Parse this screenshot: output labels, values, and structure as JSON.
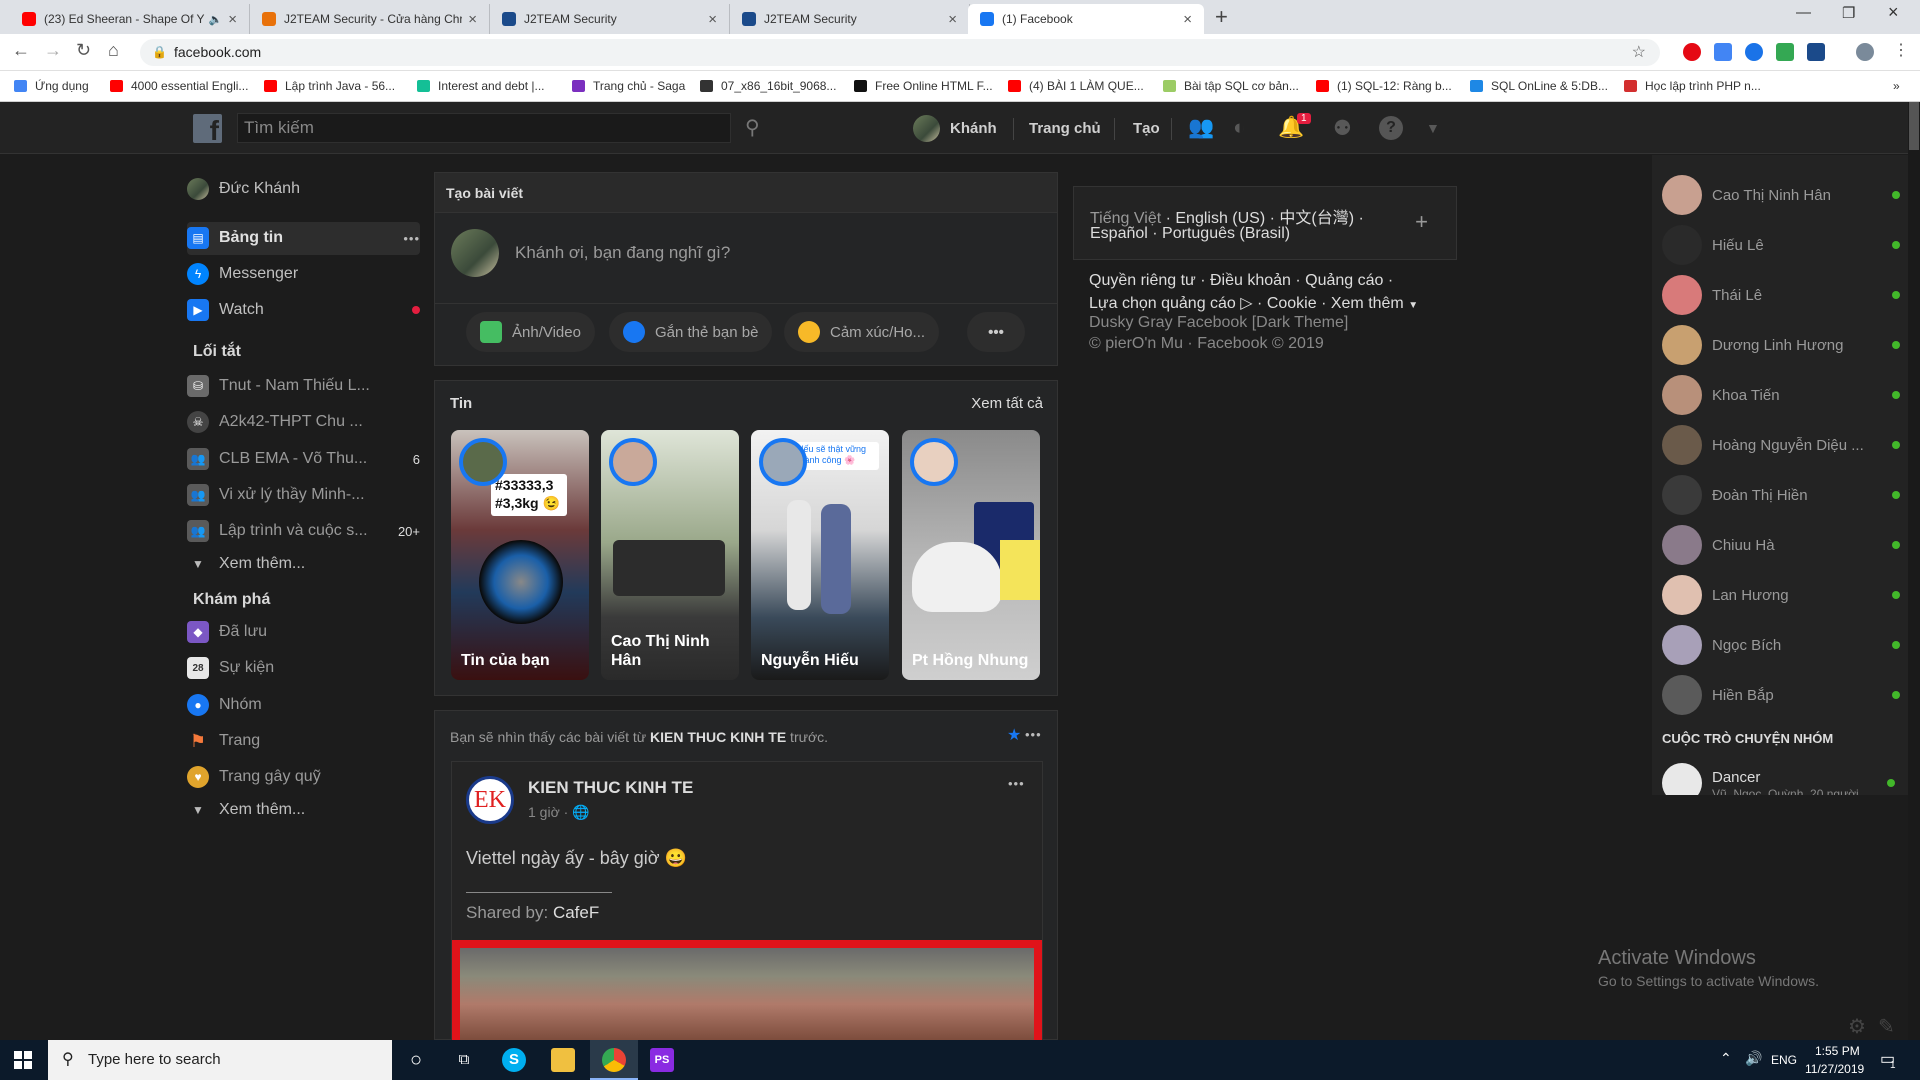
{
  "browser": {
    "tabs": [
      {
        "title": "(23) Ed Sheeran - Shape Of Y",
        "color": "#ff0000"
      },
      {
        "title": "J2TEAM Security - Cửa hàng Chr",
        "color": "#e8710a"
      },
      {
        "title": "J2TEAM Security",
        "color": "#1b4a8a"
      },
      {
        "title": "J2TEAM Security",
        "color": "#1b4a8a"
      },
      {
        "title": "(1) Facebook",
        "color": "#1877f2"
      }
    ],
    "new_tab": "+",
    "url": "facebook.com",
    "bookmarks": [
      {
        "label": "Ứng dụng",
        "color": "#4285f4"
      },
      {
        "label": "4000 essential Engli...",
        "color": "#ff0000"
      },
      {
        "label": "Lập trình Java - 56...",
        "color": "#ff0000"
      },
      {
        "label": "Interest and debt |...",
        "color": "#14bf96"
      },
      {
        "label": "Trang chủ - Saga",
        "color": "#7b2fbf"
      },
      {
        "label": "07_x86_16bit_9068...",
        "color": "#333333"
      },
      {
        "label": "Free Online HTML F...",
        "color": "#111111"
      },
      {
        "label": "(4) BÀI 1 LÀM QUE...",
        "color": "#ff0000"
      },
      {
        "label": "Bài tập SQL cơ bản...",
        "color": "#9ccc65"
      },
      {
        "label": "(1) SQL-12: Ràng b...",
        "color": "#ff0000"
      },
      {
        "label": "SQL OnLine & 5:DB...",
        "color": "#1e88e5"
      },
      {
        "label": "Học lập trình PHP n...",
        "color": "#d32f2f"
      }
    ],
    "more": "»"
  },
  "header": {
    "search_placeholder": "Tìm kiếm",
    "user_name": "Khánh",
    "home": "Trang chủ",
    "create": "Tạo",
    "notif_count": "1"
  },
  "left": {
    "profile": "Đức Khánh",
    "main": [
      {
        "label": "Bảng tin",
        "color": "#1877f2"
      },
      {
        "label": "Messenger",
        "color": "#0084ff"
      },
      {
        "label": "Watch",
        "color": "#1877f2"
      }
    ],
    "more_dots": "•••",
    "shortcuts_title": "Lối tắt",
    "shortcuts": [
      {
        "label": "Tnut - Nam Thiếu L...",
        "count": ""
      },
      {
        "label": "A2k42-THPT Chu ...",
        "count": ""
      },
      {
        "label": "CLB EMA - Võ Thu...",
        "count": "6"
      },
      {
        "label": "Vi xử lý thầy Minh-...",
        "count": ""
      },
      {
        "label": "Lập trình và cuộc s...",
        "count": "20+"
      }
    ],
    "see_more": "Xem thêm...",
    "explore_title": "Khám phá",
    "explore": [
      {
        "label": "Đã lưu",
        "color": "#7b57c4"
      },
      {
        "label": "Sự kiện",
        "color": "#e8e8e8"
      },
      {
        "label": "Nhóm",
        "color": "#1877f2"
      },
      {
        "label": "Trang",
        "color": "#f5793b"
      },
      {
        "label": "Trang gây quỹ",
        "color": "#e0a42c"
      }
    ],
    "explore_more": "Xem thêm..."
  },
  "composer": {
    "title": "Tạo bài viết",
    "prompt": "Khánh ơi, bạn đang nghĩ gì?",
    "actions": [
      {
        "label": "Ảnh/Video",
        "color": "#45bd62"
      },
      {
        "label": "Gắn thẻ bạn bè",
        "color": "#1877f2"
      },
      {
        "label": "Cảm xúc/Ho...",
        "color": "#f7b928"
      }
    ],
    "more": "•••"
  },
  "stories": {
    "title": "Tin",
    "see_all": "Xem tất cả",
    "items": [
      {
        "name": "Tin của bạn",
        "caption": "#33333,3\n#3,3kg 😉"
      },
      {
        "name": "Cao Thị Ninh Hân",
        "caption": ""
      },
      {
        "name": "Nguyễn Hiếu",
        "caption": "Nếu sẽ thật vững thành công 🌸"
      },
      {
        "name": "Pt Hồng Nhung",
        "caption": ""
      }
    ]
  },
  "post": {
    "notice_pre": "Bạn sẽ nhìn thấy các bài viết từ ",
    "notice_page": "KIEN THUC KINH TE",
    "notice_post": " trước.",
    "page_name": "KIEN THUC KINH TE",
    "page_initials": "EK",
    "time": "1 giờ",
    "text": "Viettel ngày ấy - bây giờ 😀",
    "shared_label": "Shared by: ",
    "shared_by": "CafeF",
    "more": "•••"
  },
  "right": {
    "languages_line1": [
      "Tiếng Việt",
      "English (US)",
      "中文(台灣)"
    ],
    "languages_line2": [
      "Español",
      "Português (Brasil)"
    ],
    "add": "+",
    "footer_line1": [
      "Quyền riêng tư",
      "Điều khoản",
      "Quảng cáo"
    ],
    "footer_line2": [
      "Lựa chọn quảng cáo",
      "Cookie",
      "Xem thêm"
    ],
    "theme": "Dusky Gray Facebook [Dark Theme]",
    "credit": "© pierO'n Mu · Facebook © 2019"
  },
  "chat": {
    "contacts": [
      "Cao Thị Ninh Hân",
      "Hiếu Lê",
      "Thái Lê",
      "Dương Linh Hương",
      "Khoa Tiến",
      "Hoàng Nguyễn Diệu ...",
      "Đoàn Thị Hiền",
      "Chiuu Hà",
      "Lan Hương",
      "Ngọc Bích",
      "Hiền Bắp"
    ],
    "group_title": "CUỘC TRÒ CHUYỆN NHÓM",
    "group_name": "Dancer",
    "group_sub": "Vũ, Ngọc, Quỳnh, 20 người"
  },
  "watermark": {
    "title": "Activate Windows",
    "sub": "Go to Settings to activate Windows."
  },
  "taskbar": {
    "search_placeholder": "Type here to search",
    "lang": "ENG",
    "time": "1:55 PM",
    "date": "11/27/2019",
    "notif": "1"
  }
}
